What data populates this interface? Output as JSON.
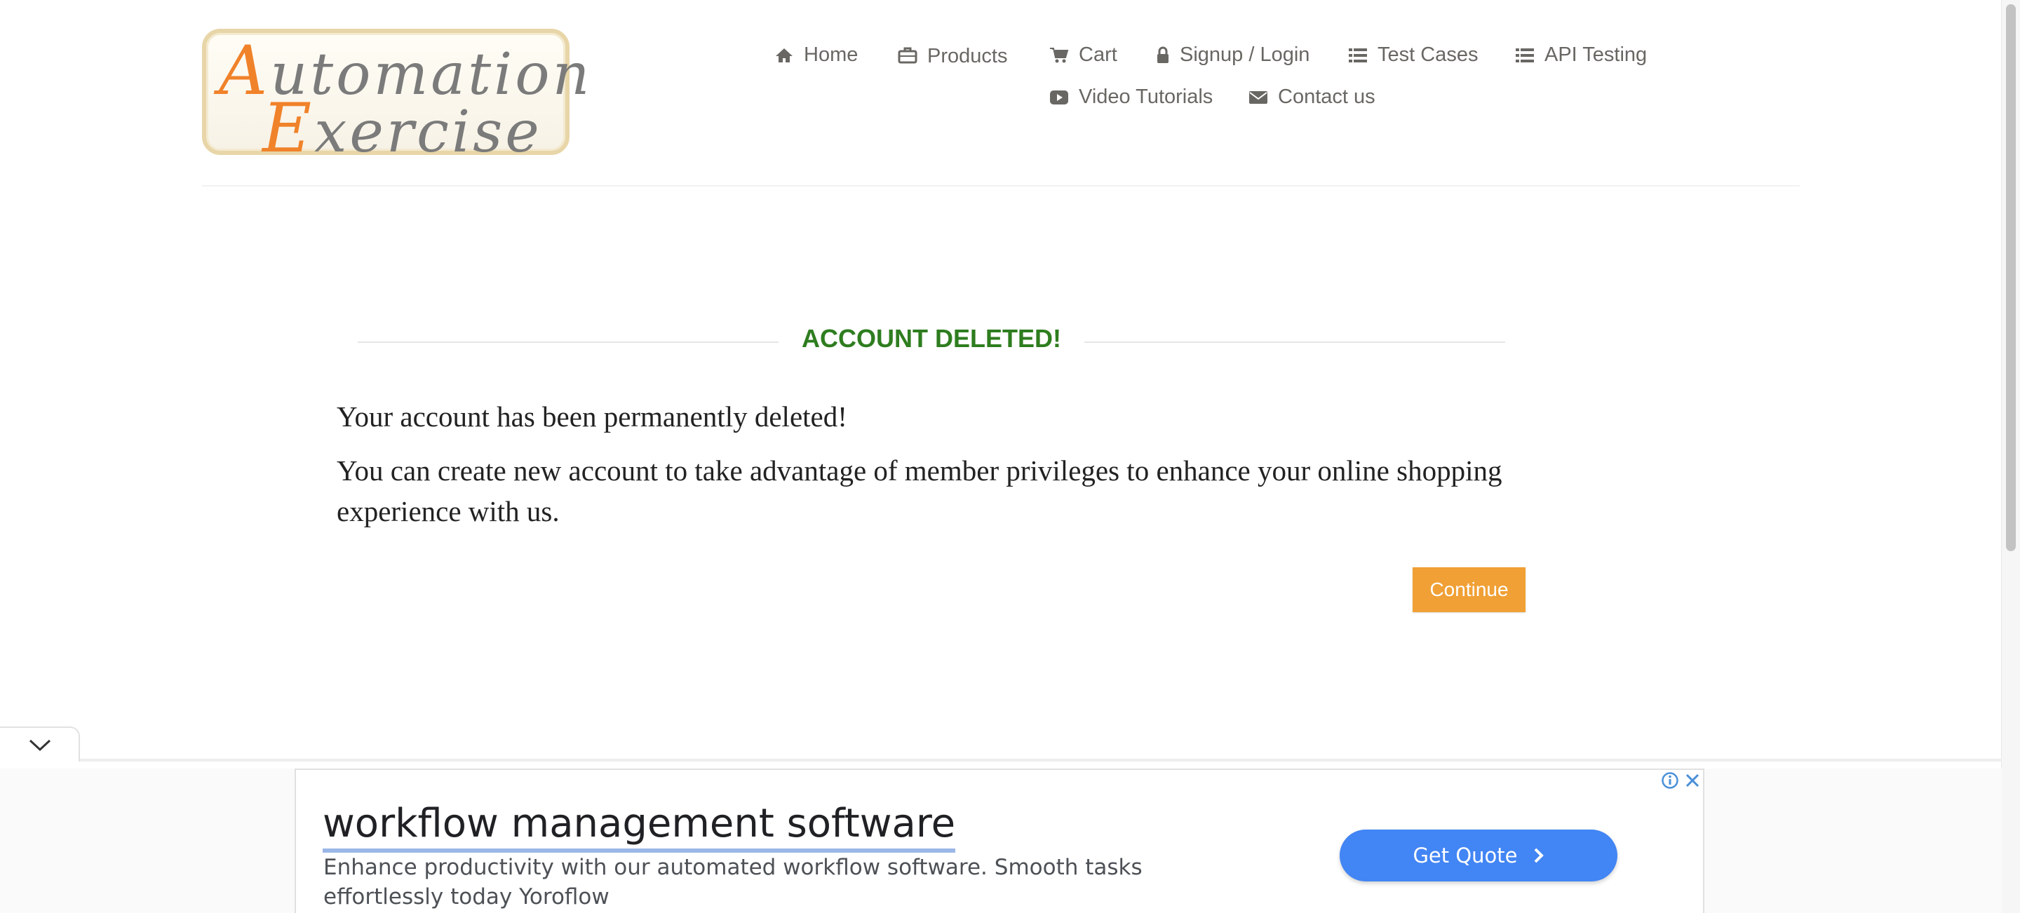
{
  "logo": {
    "cap1": "A",
    "line1": "utomation",
    "cap2": "E",
    "line2": "xercise"
  },
  "nav": {
    "home": "Home",
    "products": "Products",
    "cart": "Cart",
    "signup": "Signup / Login",
    "test_cases": "Test Cases",
    "api_testing": "API Testing",
    "video_tutorials": "Video Tutorials",
    "contact": "Contact us"
  },
  "main": {
    "title": "ACCOUNT DELETED!",
    "paragraph1": "Your account has been permanently deleted!",
    "paragraph2": "You can create new account to take advantage of member privileges to enhance your online shopping experience with us.",
    "continue_label": "Continue"
  },
  "ad": {
    "title": "workflow management software",
    "description": "Enhance productivity with our automated workflow software. Smooth tasks effortlessly today Yoroflow",
    "cta_label": "Get Quote"
  },
  "colors": {
    "title_green": "#2e7d1f",
    "continue_orange": "#f0a035",
    "ad_button_blue": "#4285f4",
    "logo_orange": "#f0822a"
  },
  "icons": [
    "home-icon",
    "briefcase-icon",
    "cart-icon",
    "lock-icon",
    "list-icon",
    "youtube-icon",
    "envelope-icon",
    "chevron-down-icon",
    "info-icon",
    "close-icon",
    "chevron-right-icon"
  ]
}
